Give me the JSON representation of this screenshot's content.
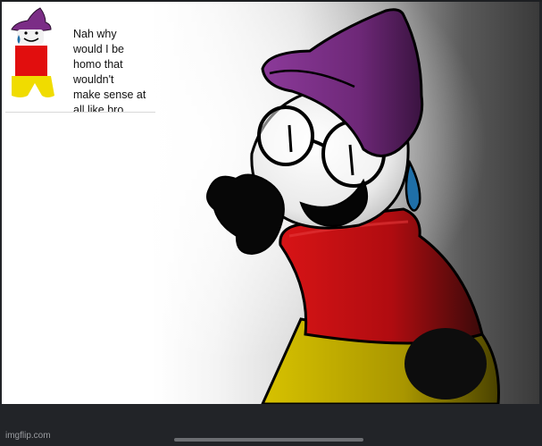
{
  "panel": {
    "caption": "Nah why\nwould I be\nhomo that\nwouldn't\nmake sense at\nall like bro"
  },
  "watermark": {
    "text": "imgflip.com"
  },
  "colors": {
    "hat": "#7b2d86",
    "shirt": "#c50f12",
    "pants": "#c9b400",
    "outline": "#000000",
    "tear": "#1f6fa8",
    "shadow_bg": "#3a3a3a"
  }
}
